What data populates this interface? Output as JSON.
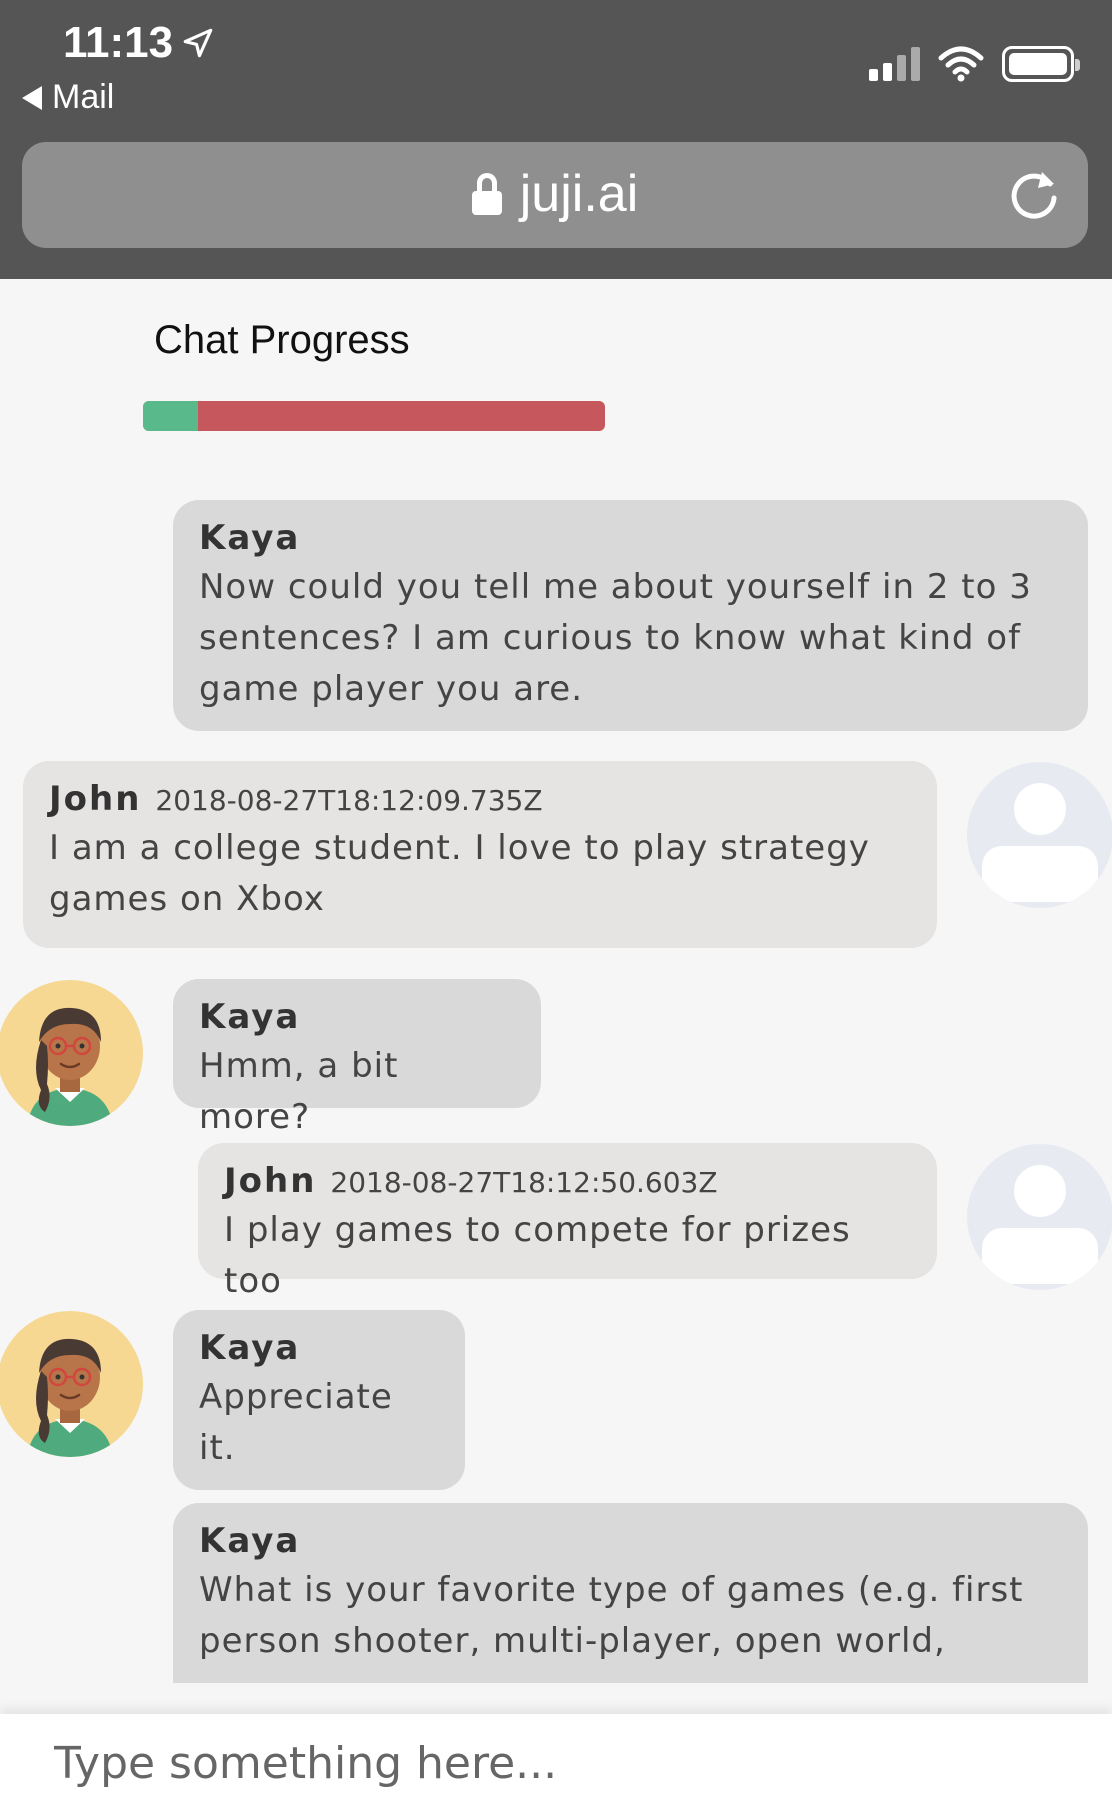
{
  "status_bar": {
    "time": "11:13",
    "back_label": "Mail"
  },
  "browser": {
    "url": "juji.ai"
  },
  "progress": {
    "title": "Chat Progress",
    "completed_fraction": 0.12,
    "colors": {
      "done": "#5ab98a",
      "remaining": "#c6575c"
    }
  },
  "messages": [
    {
      "sender": "Kaya",
      "role": "bot",
      "timestamp": "",
      "text": "Now could you tell me about yourself in 2 to 3 sentences? I am curious to know what kind of game player you are."
    },
    {
      "sender": "John",
      "role": "user",
      "timestamp": "2018-08-27T18:12:09.735Z",
      "text": "I am a college student. I love to play strategy games on Xbox"
    },
    {
      "sender": "Kaya",
      "role": "bot",
      "timestamp": "",
      "text": "Hmm, a bit more?"
    },
    {
      "sender": "John",
      "role": "user",
      "timestamp": "2018-08-27T18:12:50.603Z",
      "text": "I play games to compete for prizes too"
    },
    {
      "sender": "Kaya",
      "role": "bot",
      "timestamp": "",
      "text": "Appreciate it."
    },
    {
      "sender": "Kaya",
      "role": "bot",
      "timestamp": "",
      "text": "What is your favorite type of games (e.g. first person shooter, multi-player, open world,"
    }
  ],
  "input": {
    "placeholder": "Type something here..."
  }
}
